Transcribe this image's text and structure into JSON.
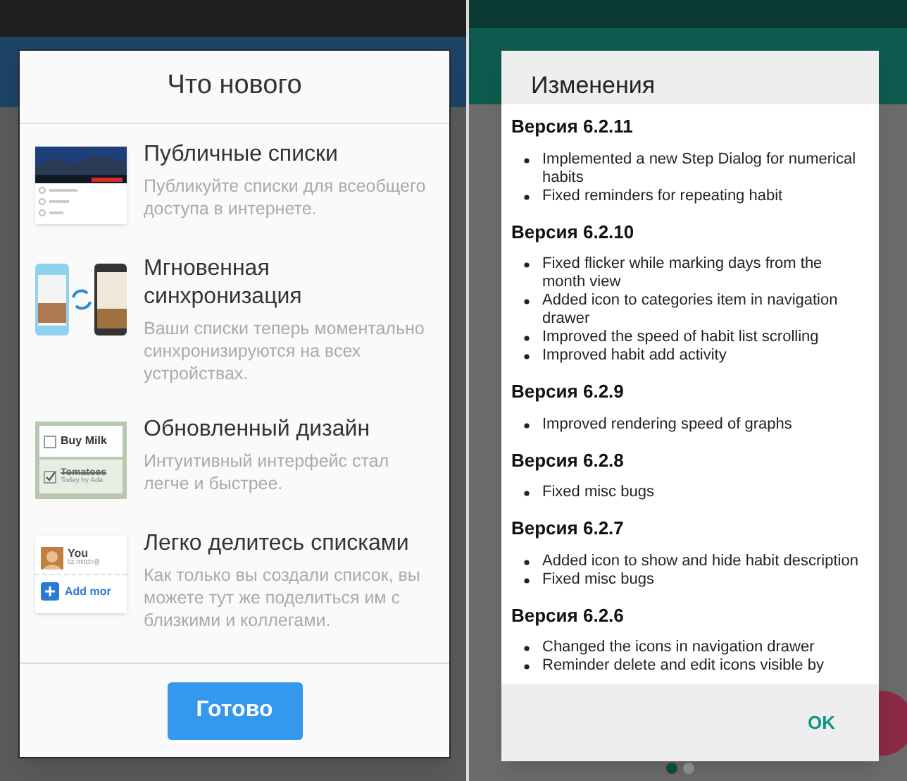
{
  "left_screen": {
    "dialog": {
      "title": "Что нового",
      "items": [
        {
          "kind": "banner",
          "title": "Публичные списки",
          "description": "Публикуйте списки для всеобщего доступа в интернете."
        },
        {
          "kind": "sync",
          "title": "Мгновенная синхронизация",
          "description": "Ваши списки теперь моментально синхронизируются на всех устройствах."
        },
        {
          "kind": "checklist",
          "title": "Обновленный дизайн",
          "description": "Интуитивный интерфейс стал легче и быстрее.",
          "thumb_rows": [
            {
              "label": "Buy Milk",
              "checked": false
            },
            {
              "label": "Tomatoes",
              "meta": "Today by Ada",
              "checked": true
            }
          ]
        },
        {
          "kind": "share",
          "title": "Легко делитесь списками",
          "description": "Как только вы создали список, вы можете тут же поделиться им с близкими и коллегами.",
          "thumb_texts": [
            "You",
            "liz.mitch@",
            "Add mor"
          ]
        }
      ],
      "done_button": "Готово"
    }
  },
  "right_screen": {
    "dialog": {
      "title": "Изменения",
      "versions": [
        {
          "heading": "Версия 6.2.11",
          "changes": [
            "Implemented a new Step Dialog for numerical habits",
            "Fixed reminders for repeating habit"
          ]
        },
        {
          "heading": "Версия 6.2.10",
          "changes": [
            "Fixed flicker while marking days from the month view",
            "Added icon to categories item in navigation drawer",
            "Improved the speed of habit list scrolling",
            "Improved habit add activity"
          ]
        },
        {
          "heading": "Версия 6.2.9",
          "changes": [
            "Improved rendering speed of graphs"
          ]
        },
        {
          "heading": "Версия 6.2.8",
          "changes": [
            "Fixed misc bugs"
          ]
        },
        {
          "heading": "Версия 6.2.7",
          "changes": [
            "Added icon to show and hide habit description",
            "Fixed misc bugs"
          ]
        },
        {
          "heading": "Версия 6.2.6",
          "changes": [
            "Changed the icons in navigation drawer",
            "Reminder delete and edit icons visible by"
          ]
        }
      ],
      "ok_button": "OK"
    },
    "pager": [
      {
        "selected": true
      },
      {
        "selected": false
      }
    ]
  }
}
